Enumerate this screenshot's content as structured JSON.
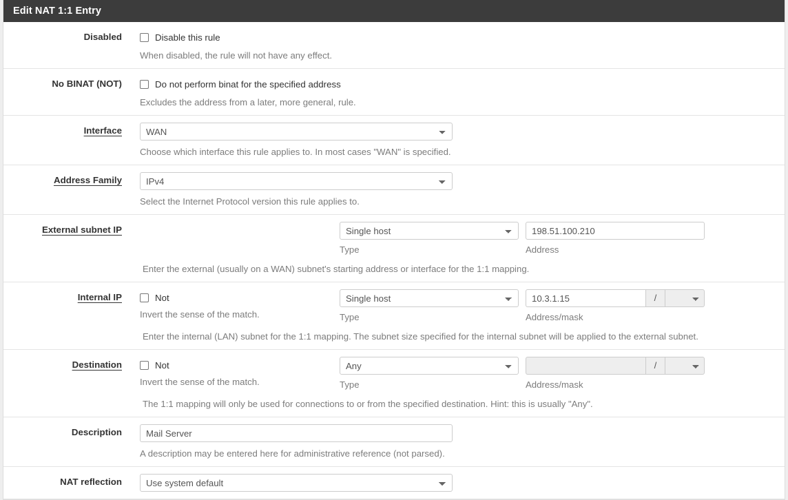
{
  "panel": {
    "title": "Edit NAT 1:1 Entry"
  },
  "rows": {
    "disabled": {
      "label": "Disabled",
      "checkbox_label": "Disable this rule",
      "help": "When disabled, the rule will not have any effect."
    },
    "no_binat": {
      "label": "No BINAT (NOT)",
      "checkbox_label": "Do not perform binat for the specified address",
      "help": "Excludes the address from a later, more general, rule."
    },
    "interface": {
      "label": "Interface",
      "value": "WAN",
      "help": "Choose which interface this rule applies to. In most cases \"WAN\" is specified."
    },
    "address_family": {
      "label": "Address Family",
      "value": "IPv4",
      "help": "Select the Internet Protocol version this rule applies to."
    },
    "external_subnet_ip": {
      "label": "External subnet IP",
      "type_value": "Single host",
      "type_sublabel": "Type",
      "address_value": "198.51.100.210",
      "address_sublabel": "Address",
      "help": "Enter the external (usually on a WAN) subnet's starting address or interface for the 1:1 mapping."
    },
    "internal_ip": {
      "label": "Internal IP",
      "not_label": "Not",
      "not_help": "Invert the sense of the match.",
      "type_value": "Single host",
      "type_sublabel": "Type",
      "address_value": "10.3.1.15",
      "mask_value": "",
      "slash": "/",
      "address_sublabel": "Address/mask",
      "help": "Enter the internal (LAN) subnet for the 1:1 mapping. The subnet size specified for the internal subnet will be applied to the external subnet."
    },
    "destination": {
      "label": "Destination",
      "not_label": "Not",
      "not_help": "Invert the sense of the match.",
      "type_value": "Any",
      "type_sublabel": "Type",
      "address_value": "",
      "mask_value": "",
      "slash": "/",
      "address_sublabel": "Address/mask",
      "help": "The 1:1 mapping will only be used for connections to or from the specified destination. Hint: this is usually \"Any\"."
    },
    "description": {
      "label": "Description",
      "value": "Mail Server",
      "placeholder": "",
      "help": "A description may be entered here for administrative reference (not parsed)."
    },
    "nat_reflection": {
      "label": "NAT reflection",
      "value": "Use system default"
    }
  },
  "colors": {
    "header_bg": "#3c3c3c",
    "page_bg": "#eeeeee",
    "panel_bg": "#ffffff",
    "help_text": "#7c7c7c",
    "label_text": "#333333"
  }
}
